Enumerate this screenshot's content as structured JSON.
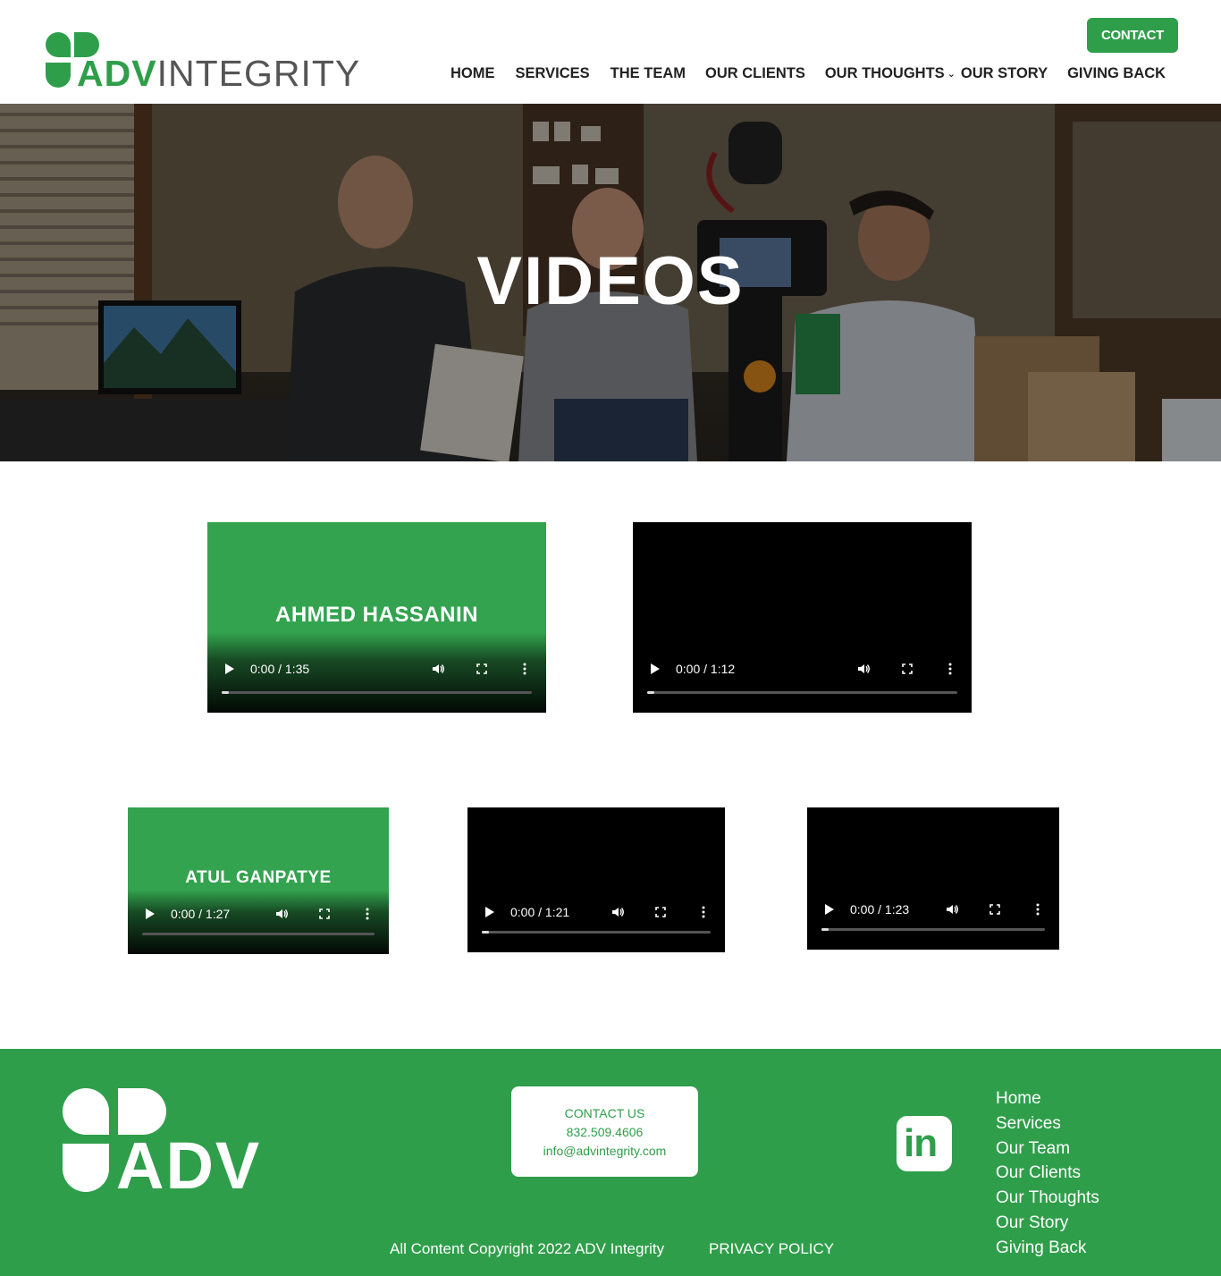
{
  "brand": {
    "logo_adv": "ADV",
    "logo_integrity": "INTEGRITY",
    "green": "#2f9e4a"
  },
  "header": {
    "contact_label": "CONTACT",
    "nav": [
      {
        "label": "HOME"
      },
      {
        "label": "SERVICES"
      },
      {
        "label": "THE TEAM"
      },
      {
        "label": "OUR CLIENTS"
      },
      {
        "label": "OUR THOUGHTS",
        "icon": "chevron-down-icon"
      },
      {
        "label": "OUR STORY"
      },
      {
        "label": "GIVING BACK"
      }
    ]
  },
  "hero": {
    "title": "VIDEOS"
  },
  "videos": [
    {
      "name": "AHMED HASSANIN",
      "time": "0:00 / 1:35"
    },
    {
      "name": "",
      "time": "0:00 / 1:12"
    },
    {
      "name": "ATUL GANPATYE",
      "time": "0:00 / 1:27"
    },
    {
      "name": "",
      "time": "0:00 / 1:21"
    },
    {
      "name": "",
      "time": "0:00 / 1:23"
    }
  ],
  "footer": {
    "logo_text": "ADV",
    "contact_title": "CONTACT US",
    "phone": "832.509.4606",
    "email": "info@advintegrity.com",
    "social_icon": "linkedin-icon",
    "social_text": "in",
    "links": [
      "Home",
      "Services",
      "Our Team",
      "Our Clients",
      "Our Thoughts",
      "Our Story",
      "Giving Back"
    ],
    "copyright": "All Content Copyright 2022 ADV Integrity",
    "privacy": "PRIVACY POLICY"
  }
}
